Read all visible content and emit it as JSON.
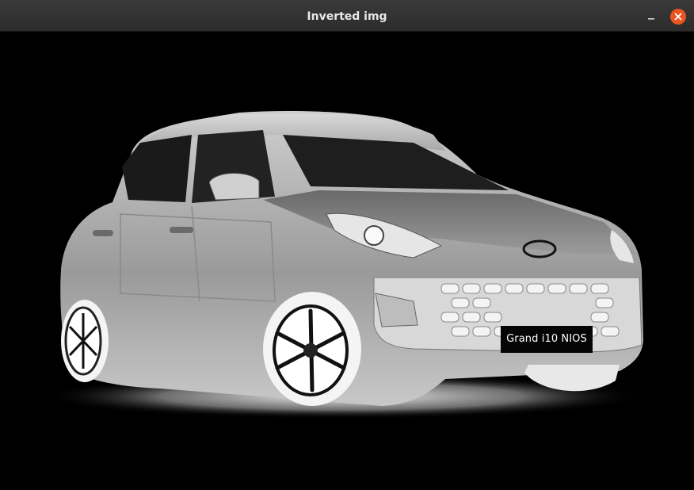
{
  "window": {
    "title": "Inverted img"
  },
  "controls": {
    "minimize_icon": "minimize-icon",
    "close_icon": "close-icon",
    "close_color": "#e95420"
  },
  "image": {
    "badge_text": "Grand i10 NIOS",
    "subject": "inverted-car-photo",
    "background": "#000000"
  }
}
